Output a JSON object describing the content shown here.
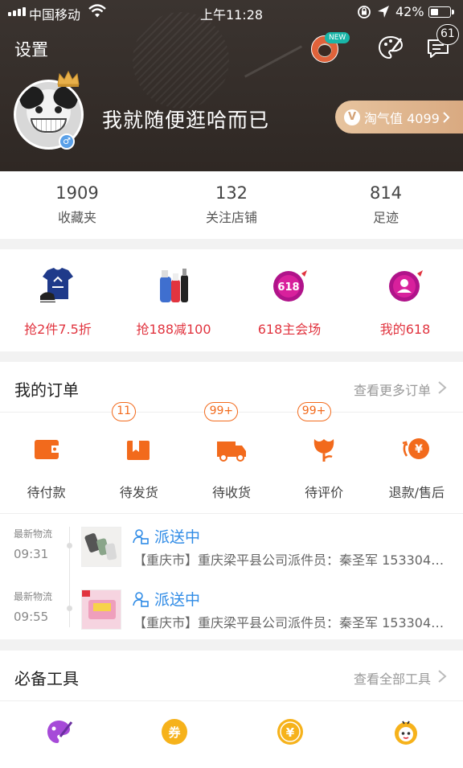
{
  "status_bar": {
    "carrier": "中国移动",
    "time": "上午11:28",
    "battery": "42%",
    "battery_level": 0.42
  },
  "header": {
    "settings_label": "设置",
    "new_badge": "NEW",
    "message_count": "61",
    "username": "我就随便逛哈而已",
    "taoqi_icon": "V",
    "taoqi_label": "淘气值 4099",
    "gender_symbol": "♂"
  },
  "stats": [
    {
      "value": "1909",
      "label": "收藏夹"
    },
    {
      "value": "132",
      "label": "关注店铺"
    },
    {
      "value": "814",
      "label": "足迹"
    }
  ],
  "promos": [
    {
      "label": "抢2件7.5折",
      "icon": "tshirt-shoe-icon"
    },
    {
      "label": "抢188减100",
      "icon": "shampoo-icon"
    },
    {
      "label": "618主会场",
      "icon": "618-badge-icon",
      "badge_text": "618"
    },
    {
      "label": "我的618",
      "icon": "user-badge-icon"
    }
  ],
  "orders": {
    "title": "我的订单",
    "more_label": "查看更多订单",
    "items": [
      {
        "label": "待付款",
        "icon": "wallet-icon",
        "count": ""
      },
      {
        "label": "待发货",
        "icon": "package-icon",
        "count": "11"
      },
      {
        "label": "待收货",
        "icon": "truck-icon",
        "count": "99+"
      },
      {
        "label": "待评价",
        "icon": "flower-icon",
        "count": "99+"
      },
      {
        "label": "退款/售后",
        "icon": "refund-icon",
        "count": "",
        "yuan": "¥"
      }
    ],
    "logistics": [
      {
        "latest_label": "最新物流",
        "time": "09:31",
        "status": "派送中",
        "desc": "【重庆市】重庆梁平县公司派件员：秦圣军 153304…"
      },
      {
        "latest_label": "最新物流",
        "time": "09:55",
        "status": "派送中",
        "desc": "【重庆市】重庆梁平县公司派件员：秦圣军 153304…"
      }
    ]
  },
  "tools": {
    "title": "必备工具",
    "more_label": "查看全部工具",
    "items": [
      {
        "icon": "palette-tool-icon"
      },
      {
        "icon": "coupon-icon",
        "glyph": "券"
      },
      {
        "icon": "yuan-coin-icon",
        "glyph": "¥"
      },
      {
        "icon": "bee-icon"
      }
    ]
  },
  "colors": {
    "header_bg": "#2f2824",
    "promo_text": "#e1343f",
    "order_accent": "#f26a1c",
    "logistics_blue": "#2f8be6",
    "taoqi_gold": "#d8a87f"
  }
}
